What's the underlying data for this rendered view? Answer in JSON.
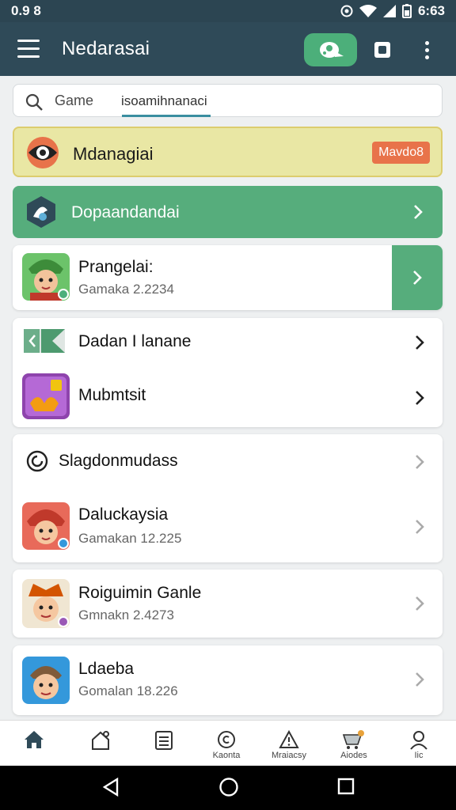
{
  "status_bar": {
    "time_left": "0.9 8",
    "time_right": "6:63"
  },
  "app_bar": {
    "title": "Nedarasai"
  },
  "search": {
    "label": "Game",
    "value": "isoamihnanaci"
  },
  "promo_yellow": {
    "title": "Mdanagiai",
    "badge": "Mavdo8"
  },
  "promo_green": {
    "title": "Dopaandandai"
  },
  "featured": {
    "name": "Prangelai:",
    "sub": "Gamaka 2.2234"
  },
  "group1": [
    {
      "name": "Dadan I lanane"
    },
    {
      "name": "Mubmtsit"
    }
  ],
  "group2": {
    "header": "Slagdonmudass",
    "item": {
      "name": "Daluckaysia",
      "sub": "Gamakan 12.225"
    }
  },
  "card3": {
    "name": "Roiguimin Ganle",
    "sub": "Gmnakn 2.4273"
  },
  "card4": {
    "name": "Ldaeba",
    "sub": "Gomalan 18.226"
  },
  "bottom_nav": [
    {
      "label": ""
    },
    {
      "label": ""
    },
    {
      "label": ""
    },
    {
      "label": "Kaonta"
    },
    {
      "label": "Mraiacsy"
    },
    {
      "label": "Aiodes"
    },
    {
      "label": "Iic"
    }
  ],
  "colors": {
    "app_bar": "#2f4a58",
    "accent_green": "#56ad7c",
    "promo_yellow": "#e9e7a4",
    "badge": "#e8734a"
  }
}
